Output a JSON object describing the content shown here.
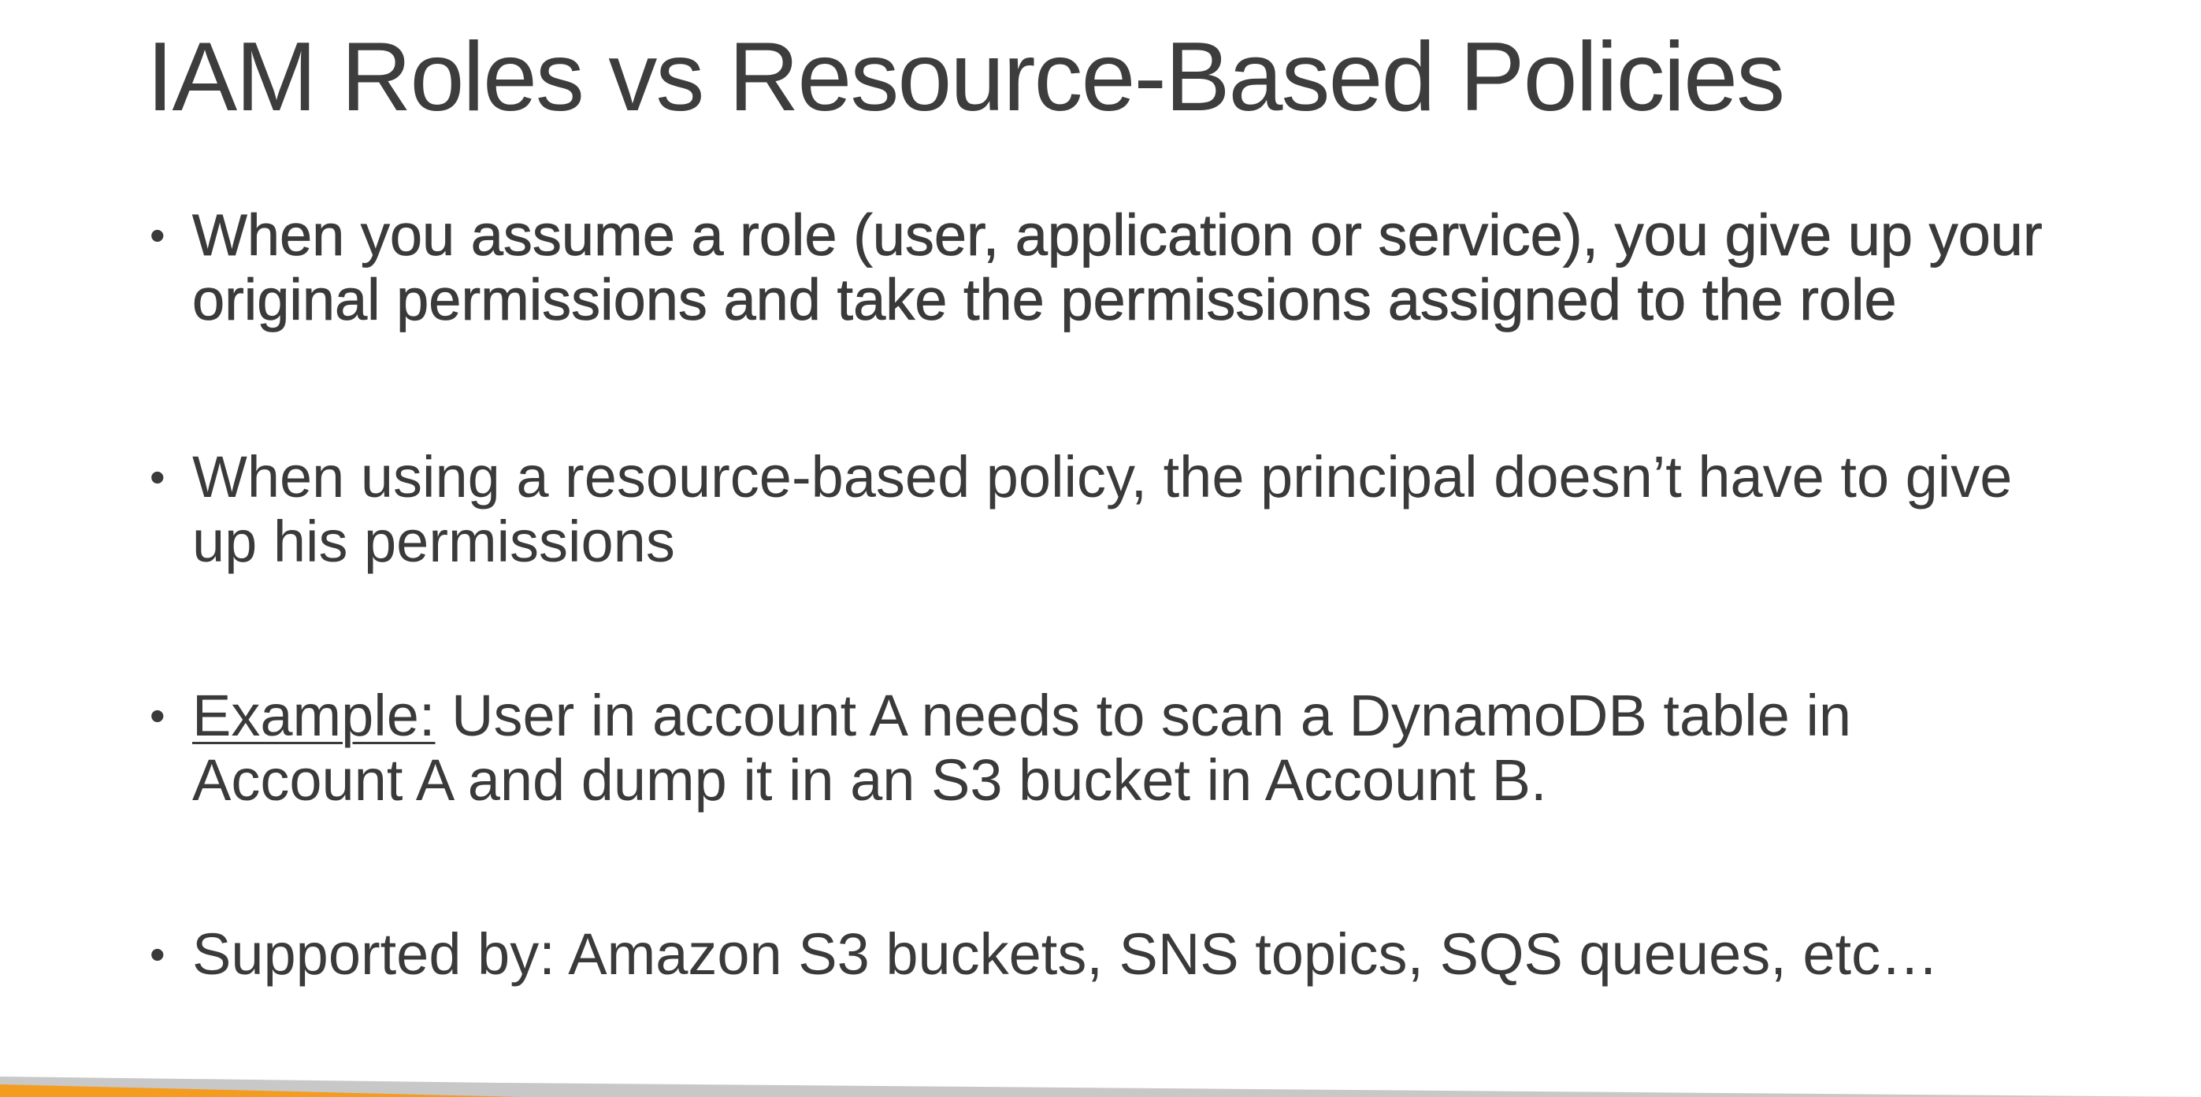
{
  "slide": {
    "title": "IAM Roles vs Resource-Based Policies",
    "bullets": [
      {
        "marker": "•",
        "line1": "When you assume a role (user, application or service), you give up your",
        "line2": "original permissions and take the permissions assigned to the role"
      },
      {
        "marker": "•",
        "line1": "When using a resource-based policy, the principal doesn’t have to give",
        "line2": "up his permissions"
      },
      {
        "marker": "•",
        "label": "Example:",
        "line1": " User in account A needs to scan a DynamoDB table in",
        "line2": "Account A and dump it in an S3 bucket in Account B."
      },
      {
        "marker": "•",
        "line1": "Supported by: Amazon S3 buckets, SNS topics, SQS queues, etc…"
      }
    ]
  },
  "colors": {
    "background": "#ffffff",
    "text": "#3a3a3a",
    "accent_orange": "#f39c1f",
    "accent_gray": "#c8c8c8"
  }
}
